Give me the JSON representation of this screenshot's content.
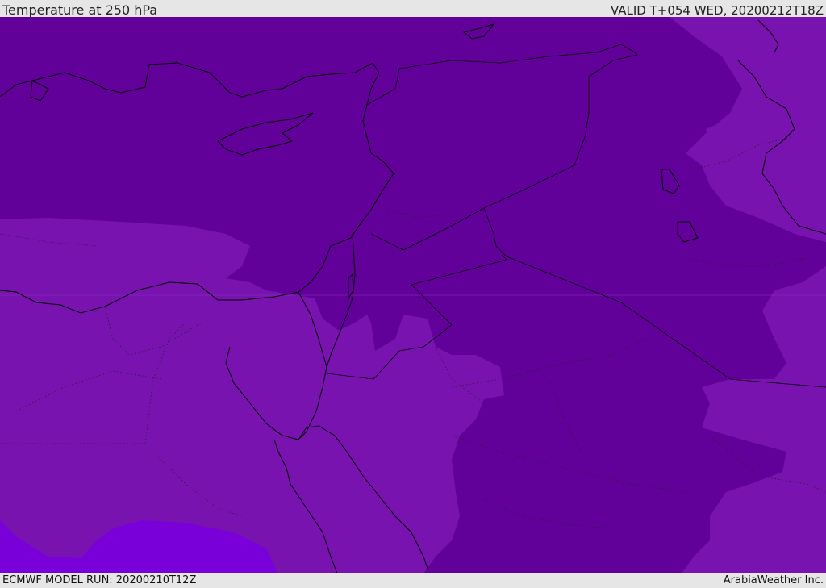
{
  "header": {
    "title": "Temperature at 250 hPa",
    "valid": "VALID T+054 WED, 20200212T18Z"
  },
  "footer": {
    "model_run": "ECMWF MODEL RUN: 20200210T12Z",
    "credit": "ArabiaWeather Inc."
  },
  "map": {
    "field": "temperature_250hPa",
    "colors": {
      "coldest_band": "#62009a",
      "mid_band": "#7813b0",
      "warm_band": "#7a00da",
      "coastline": "#000000"
    }
  }
}
